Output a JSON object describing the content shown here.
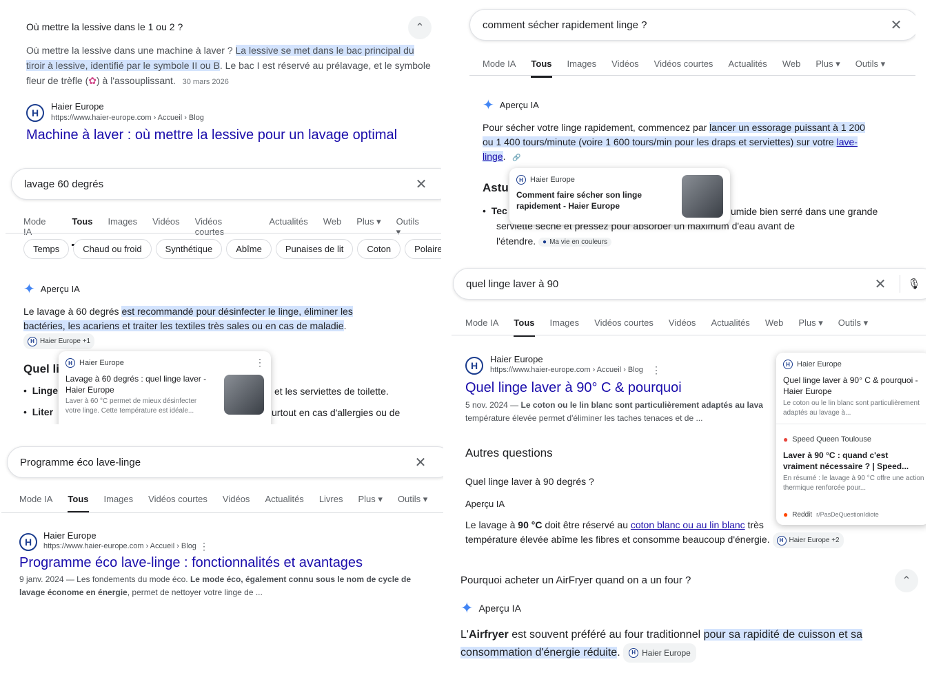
{
  "p1": {
    "question": "Où mettre la lessive dans le 1 ou 2 ?",
    "chevron": "⌃",
    "answer_a": "Où mettre la lessive dans une machine à laver ? ",
    "answer_hl": "La lessive se met dans le bac principal du tiroir à lessive, identifié par le symbole II ou B",
    "answer_b": ". Le bac I est réservé au prélavage, et le symbole fleur de trèfle (",
    "answer_c": ") à l'assouplissant.",
    "date": "30 mars 2026",
    "site": "Haier Europe",
    "url": "https://www.haier-europe.com › Accueil › Blog",
    "title": "Machine à laver : où mettre la lessive pour un lavage optimal"
  },
  "p2": {
    "query": "lavage 60 degrés",
    "tabs": [
      "Mode IA",
      "Tous",
      "Images",
      "Vidéos",
      "Vidéos courtes",
      "Actualités",
      "Web",
      "Plus ▾",
      "Outils ▾"
    ],
    "chips": [
      "Temps",
      "Chaud ou froid",
      "Synthétique",
      "Abîme",
      "Punaises de lit",
      "Coton",
      "Polaire"
    ],
    "ai_label": "Aperçu IA",
    "ai_a": "Le lavage à 60 degrés ",
    "ai_b": "est recommandé pour désinfecter le linge, éliminer les bactéries, les acariens et traiter les textiles très sales ou en cas de maladie",
    "ai_c": ".",
    "badge": "Haier Europe +1",
    "heading": "Quel li",
    "bullet1_a": "Linge",
    "bullet1_b": "et les serviettes de toilette.",
    "bullet2_a": "Liter",
    "bullet2_b": "urtout en cas d'allergies ou de",
    "card": {
      "site": "Haier Europe",
      "title": "Lavage à 60 degrés : quel linge laver - Haier Europe",
      "desc": "Laver à 60 °C permet de mieux désinfecter votre linge. Cette température est idéale..."
    }
  },
  "p3": {
    "query": "Programme éco lave-linge",
    "tabs": [
      "Mode IA",
      "Tous",
      "Images",
      "Vidéos courtes",
      "Vidéos",
      "Actualités",
      "Livres",
      "Plus ▾",
      "Outils ▾"
    ],
    "site": "Haier Europe",
    "url": "https://www.haier-europe.com › Accueil › Blog",
    "title": "Programme éco lave-linge : fonctionnalités et avantages",
    "date": "9 janv. 2024",
    "snip_a": " — Les fondements du mode éco. ",
    "snip_b": "Le mode éco, également connu sous le nom de cycle de lavage économe en énergie",
    "snip_c": ", permet de nettoyer votre linge de ..."
  },
  "p4": {
    "query": "comment sécher rapidement linge ?",
    "tabs": [
      "Mode IA",
      "Tous",
      "Images",
      "Vidéos",
      "Vidéos courtes",
      "Actualités",
      "Web",
      "Plus ▾",
      "Outils ▾"
    ],
    "ai_label": "Aperçu IA",
    "ai_a": "Pour sécher votre linge rapidement, commencez par ",
    "ai_hl": "lancer un essorage puissant à 1 200 ou 1 400 tours/minute (voire 1 600 tours/min pour les draps et serviettes) sur votre ",
    "ai_link": "lave-linge",
    "ai_c": ".",
    "heading": "Astu",
    "bullet_a": "Tec",
    "bullet_b": "umide bien serré dans une grande",
    "line2": "serviette sèche et pressez pour absorber un maximum d'eau avant de",
    "line3": "l'étendre.",
    "badge": "Ma vie en couleurs",
    "card": {
      "site": "Haier Europe",
      "title": "Comment faire sécher son linge rapidement - Haier Europe"
    }
  },
  "p5": {
    "query": "quel linge laver à 90",
    "tabs": [
      "Mode IA",
      "Tous",
      "Images",
      "Vidéos courtes",
      "Vidéos",
      "Actualités",
      "Web",
      "Plus ▾",
      "Outils ▾"
    ],
    "site": "Haier Europe",
    "url": "https://www.haier-europe.com › Accueil › Blog",
    "title": "Quel linge laver à 90° C & pourquoi",
    "date": "5 nov. 2024",
    "snip_a": " — ",
    "snip_b": "Le coton ou le lin blanc sont particulièrement adaptés au lava",
    "snip_c": "température élevée permet d'éliminer les taches tenaces et de ...",
    "other_q": "Autres questions",
    "q1": "Quel linge laver à 90 degrés ?",
    "ai_label": "Aperçu IA",
    "ai_a": "Le lavage à ",
    "ai_bold": "90 °C",
    "ai_b": " doit être réservé au ",
    "ai_link": "coton blanc ou au lin blanc",
    "ai_c": " très",
    "ai_d": "température élevée abîme les fibres et consomme beaucoup d'énergie.",
    "badge": "Haier Europe +2",
    "side": [
      {
        "site": "Haier Europe",
        "title": "Quel linge laver à 90° C & pourquoi - Haier Europe",
        "desc": "Le coton ou le lin blanc sont particulièrement adaptés au lavage à..."
      },
      {
        "site": "Speed Queen Toulouse",
        "title": "Laver à 90 °C : quand c'est vraiment nécessaire ? | Speed...",
        "desc": "En résumé : le lavage à 90 °C offre une action thermique renforcée pour..."
      },
      {
        "site": "Reddit",
        "sub": "r/PasDeQuestionIdiote"
      }
    ]
  },
  "p6": {
    "question": "Pourquoi acheter un AirFryer quand on a un four ?",
    "ai_label": "Aperçu IA",
    "ai_a": "L'",
    "ai_bold": "Airfryer",
    "ai_b": " est souvent préféré au four traditionnel ",
    "ai_hl": "pour sa rapidité de cuisson et sa consommation d'énergie réduite",
    "ai_c": ".",
    "badge": "Haier Europe"
  },
  "colors": {
    "link": "#1a0dab",
    "highlight": "#d3e3fd",
    "ai_spark": "#4285f4"
  }
}
